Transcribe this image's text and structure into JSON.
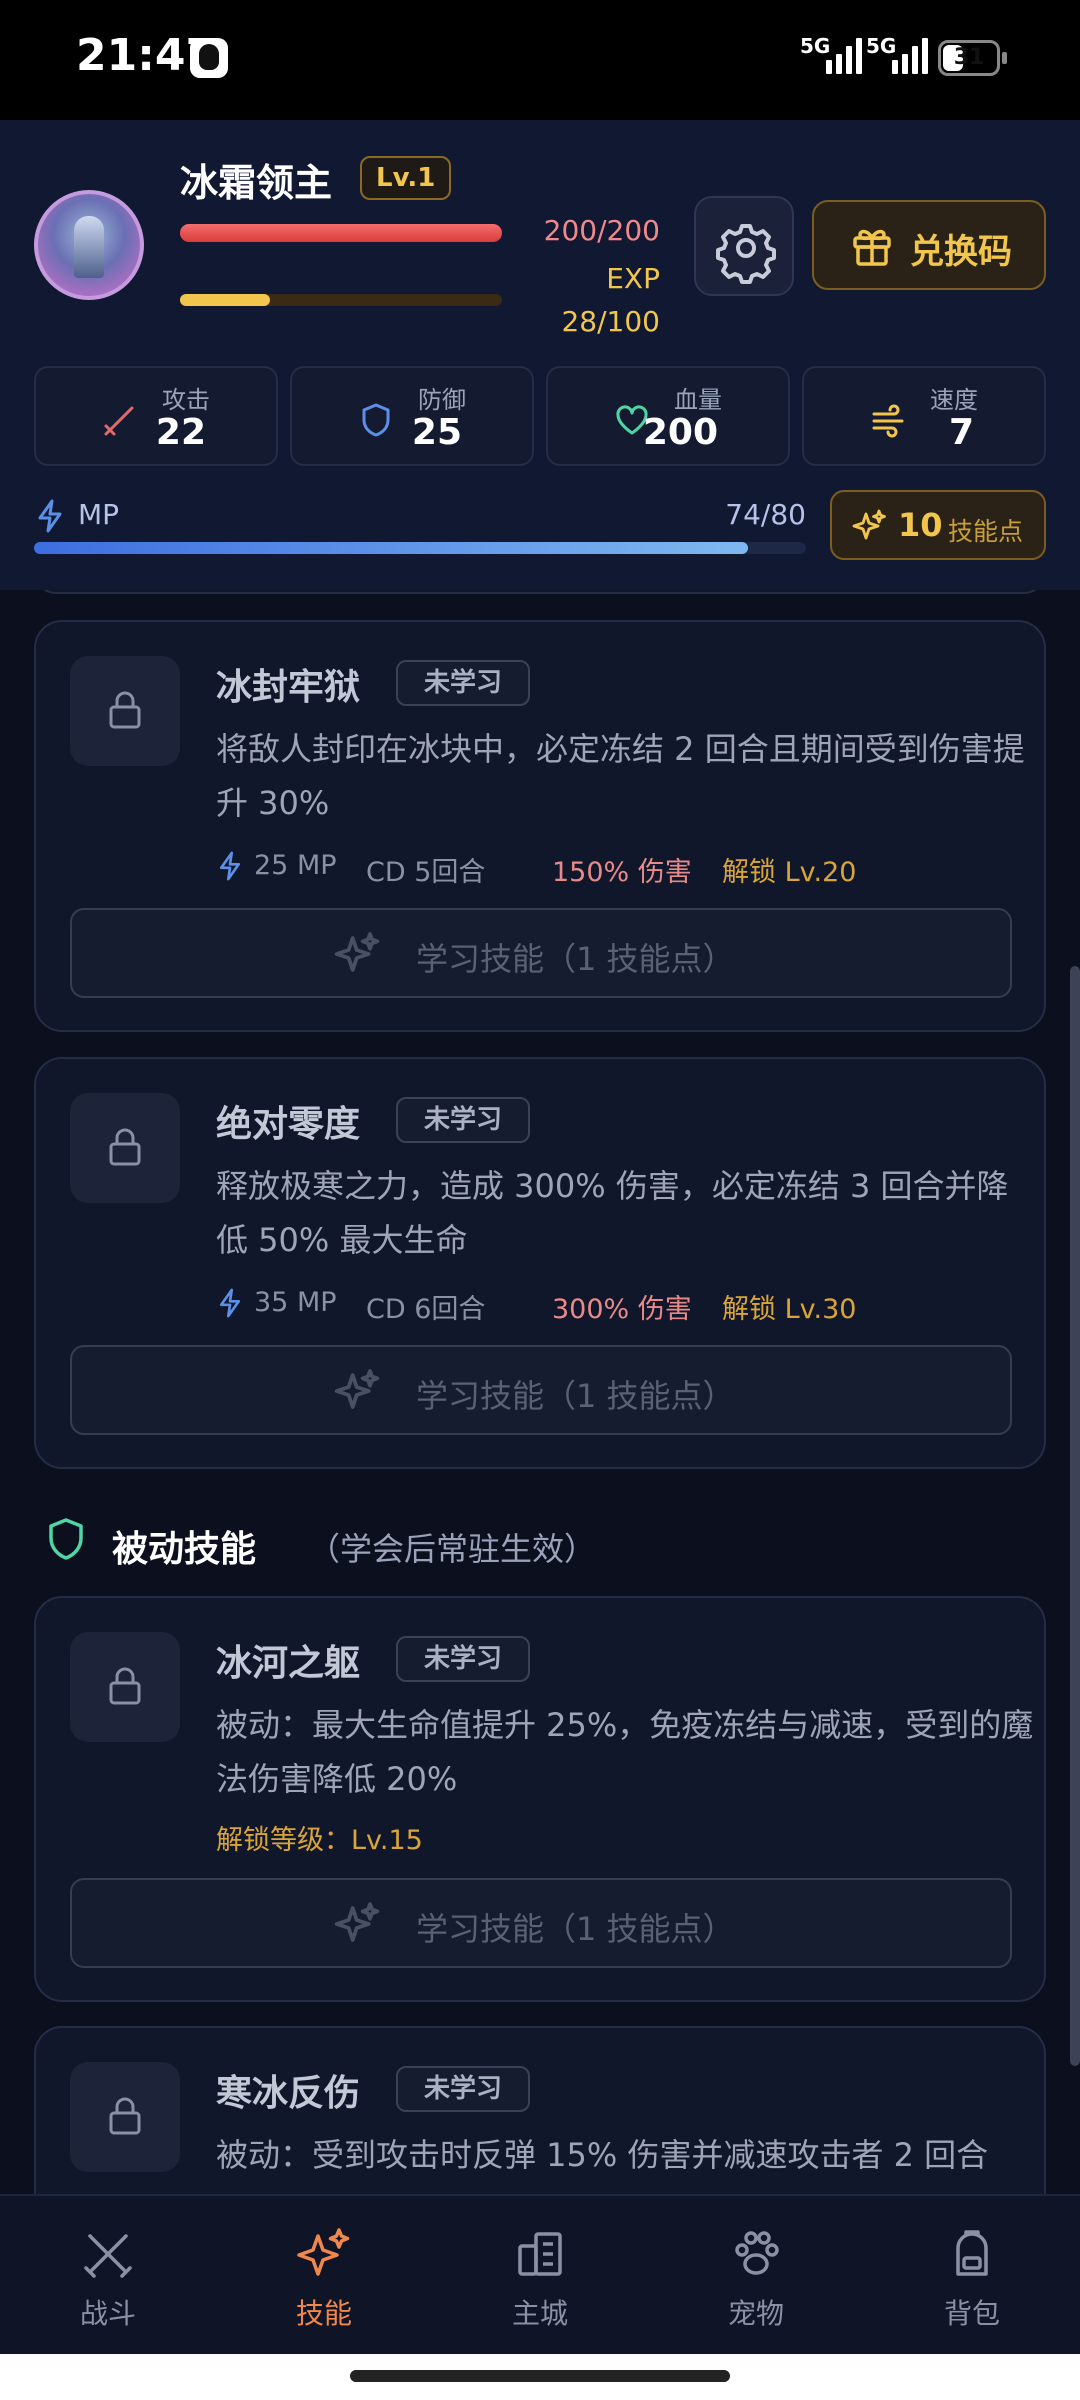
{
  "status_bar": {
    "time": "21:47",
    "net1": "5G",
    "net2": "5G",
    "battery": "31"
  },
  "player": {
    "name": "冰霜领主",
    "level": "Lv.1",
    "hp_text": "200/200",
    "hp_fraction": 1.0,
    "exp_label": "EXP",
    "exp_text": "28/100",
    "exp_fraction": 0.28
  },
  "header": {
    "redeem_label": "兑换码"
  },
  "stats": [
    {
      "label": "攻击",
      "value": "22",
      "icon": "sword-icon",
      "color": "#e06a6a"
    },
    {
      "label": "防御",
      "value": "25",
      "icon": "shield-icon",
      "color": "#5c8fe8"
    },
    {
      "label": "血量",
      "value": "200",
      "icon": "heart-icon",
      "color": "#4fd6a4"
    },
    {
      "label": "速度",
      "value": "7",
      "icon": "wind-icon",
      "color": "#f2c64c"
    }
  ],
  "mp": {
    "label": "MP",
    "text": "74/80",
    "fraction": 0.925
  },
  "skill_points": {
    "count": "10",
    "label": "技能点"
  },
  "active_skills": [
    {
      "name": "冰封牢狱",
      "status": "未学习",
      "desc": "将敌人封印在冰块中，必定冻结 2 回合且期间受到伤害提升 30%",
      "mp": "25 MP",
      "cd": "CD 5回合",
      "damage": "150% 伤害",
      "unlock": "解锁 Lv.20",
      "learn_label": "学习技能（1 技能点）"
    },
    {
      "name": "绝对零度",
      "status": "未学习",
      "desc": "释放极寒之力，造成 300% 伤害，必定冻结 3 回合并降低 50% 最大生命",
      "mp": "35 MP",
      "cd": "CD 6回合",
      "damage": "300% 伤害",
      "unlock": "解锁 Lv.30",
      "learn_label": "学习技能（1 技能点）"
    }
  ],
  "passive_section": {
    "title": "被动技能",
    "subtitle": "（学会后常驻生效）"
  },
  "passive_skills": [
    {
      "name": "冰河之躯",
      "status": "未学习",
      "desc": "被动：最大生命值提升 25%，免疫冻结与减速，受到的魔法伤害降低 20%",
      "unlock": "解锁等级：Lv.15",
      "learn_label": "学习技能（1 技能点）"
    },
    {
      "name": "寒冰反伤",
      "status": "未学习",
      "desc": "被动：受到攻击时反弹 15% 伤害并减速攻击者 2 回合"
    }
  ],
  "nav": [
    {
      "label": "战斗",
      "icon": "crossed-swords-icon",
      "active": false
    },
    {
      "label": "技能",
      "icon": "sparkle-icon",
      "active": true
    },
    {
      "label": "主城",
      "icon": "building-icon",
      "active": false
    },
    {
      "label": "宠物",
      "icon": "paw-icon",
      "active": false
    },
    {
      "label": "背包",
      "icon": "backpack-icon",
      "active": false
    }
  ],
  "colors": {
    "accent_gold": "#f2c64c",
    "accent_orange": "#f0884b",
    "hp_red": "#e04646",
    "mp_blue": "#5c8fe8",
    "damage_pink": "#e88a8a"
  }
}
